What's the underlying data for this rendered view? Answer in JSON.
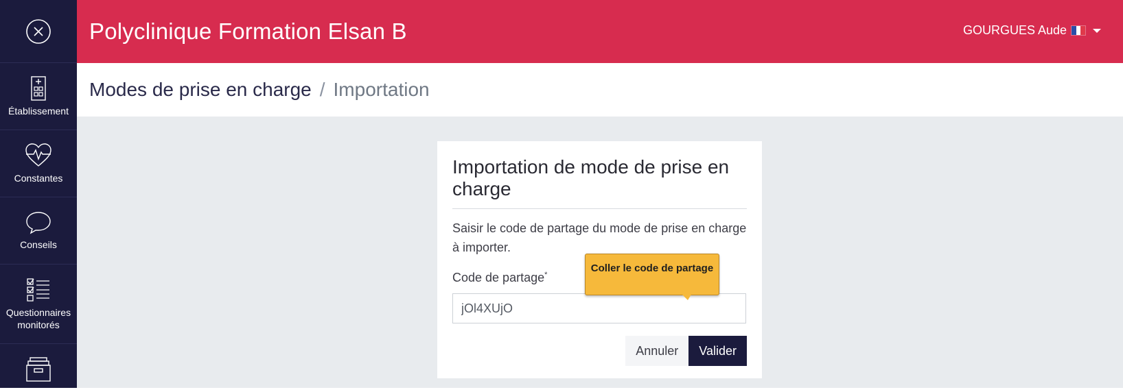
{
  "sidebar": {
    "items": [
      {
        "label": "Établissement"
      },
      {
        "label": "Constantes"
      },
      {
        "label": "Conseils"
      },
      {
        "label": "Questionnaires monitorés"
      }
    ]
  },
  "header": {
    "title": "Polyclinique Formation Elsan B",
    "user": "GOURGUES Aude"
  },
  "breadcrumb": {
    "main": "Modes de prise en charge",
    "separator": "/",
    "current": "Importation"
  },
  "dialog": {
    "title": "Importation de mode de prise en charge",
    "description": "Saisir le code de partage du mode de prise en charge à importer.",
    "field_label": "Code de partage",
    "required_mark": "*",
    "field_value": "jOl4XUjO",
    "cancel_label": "Annuler",
    "submit_label": "Valider"
  },
  "tooltip": {
    "text": "Coller le code de partage"
  },
  "colors": {
    "sidebar": "#1b1b3d",
    "header": "#d72c4f",
    "content_bg": "#e8ebee",
    "tooltip": "#f6b93b"
  }
}
